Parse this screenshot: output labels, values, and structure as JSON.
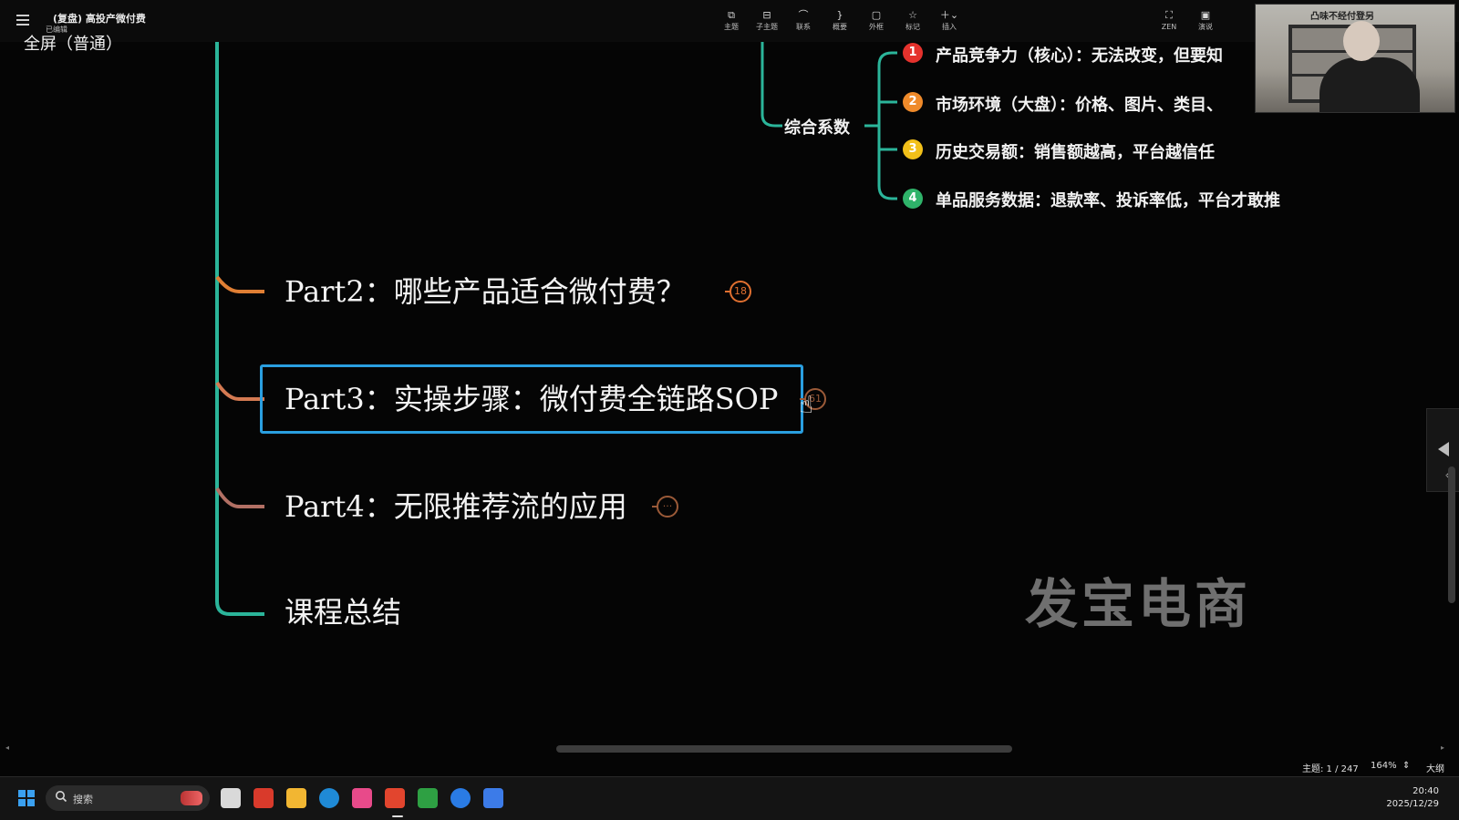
{
  "window": {
    "doc_title": "(复盘) 高投产微付费",
    "doc_subtitle": "已编辑",
    "fullscreen_label": "全屏（普通）"
  },
  "toolbar": {
    "items": [
      {
        "label": "主题",
        "icon": "topic-icon"
      },
      {
        "label": "子主题",
        "icon": "subtopic-icon"
      },
      {
        "label": "联系",
        "icon": "relationship-icon"
      },
      {
        "label": "概要",
        "icon": "summary-icon"
      },
      {
        "label": "外框",
        "icon": "boundary-icon"
      },
      {
        "label": "标记",
        "icon": "star-icon"
      },
      {
        "label": "插入",
        "icon": "plus-icon"
      }
    ],
    "zen_label": "ZEN",
    "present_label": "演说"
  },
  "mindmap": {
    "parent_node": "综合系数",
    "factors": [
      {
        "index": "1",
        "text": "产品竞争力（核心）：无法改变，但要知",
        "color": "#e5322d"
      },
      {
        "index": "2",
        "text": "市场环境（大盘）：价格、图片、类目、",
        "color": "#ef8a2a"
      },
      {
        "index": "3",
        "text": "历史交易额：销售额越高，平台越信任",
        "color": "#f2c019"
      },
      {
        "index": "4",
        "text": "单品服务数据：退款率、投诉率低，平台才敢推",
        "color": "#2fb36a"
      }
    ],
    "parts": [
      {
        "label": "Part2：哪些产品适合微付费？",
        "badge": "18"
      },
      {
        "label": "Part3：实操步骤：微付费全链路SOP",
        "badge": "61"
      },
      {
        "label": "Part4：无限推荐流的应用",
        "badge": "···"
      },
      {
        "label": "课程总结",
        "badge": ""
      }
    ],
    "branch_color": "#2bb59a",
    "accent_color": "#e07030",
    "selection_color": "#2a9fe0"
  },
  "watermark": "发宝电商",
  "webcam": {
    "sign": "凸味不经付登另"
  },
  "statusbar": {
    "topic_count": "主题: 1 / 247",
    "zoom": "164%",
    "outline_label": "大纲"
  },
  "taskbar": {
    "search_placeholder": "搜索",
    "time": "20:40",
    "date": "2025/12/29"
  }
}
